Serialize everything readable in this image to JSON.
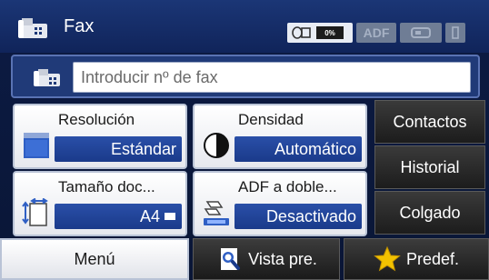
{
  "header": {
    "title": "Fax",
    "title_icon": "fax-icon",
    "status": {
      "ink_label": "0%",
      "adf_label": "ADF",
      "icons": [
        "ink-level-icon",
        "adf-icon",
        "phone-line-icon",
        "memory-icon"
      ]
    }
  },
  "fax_number": {
    "icon": "fax-icon",
    "placeholder": "Introducir nº de fax"
  },
  "settings": {
    "resolution": {
      "label": "Resolución",
      "value": "Estándar",
      "icon": "resolution-icon"
    },
    "density": {
      "label": "Densidad",
      "value": "Automático",
      "icon": "density-icon"
    },
    "doc_size": {
      "label": "Tamaño doc...",
      "value": "A4",
      "icon": "document-size-icon"
    },
    "adf_duplex": {
      "label": "ADF a doble...",
      "value": "Desactivado",
      "icon": "adf-duplex-icon"
    }
  },
  "side_menu": {
    "contacts": "Contactos",
    "history": "Historial",
    "on_hook": "Colgado"
  },
  "bottom_bar": {
    "menu": "Menú",
    "preview": "Vista pre.",
    "presets": "Predef."
  },
  "colors": {
    "accent": "#1f3f93",
    "header": "#13285f",
    "dark_button": "#262626",
    "star": "#f2c200"
  }
}
